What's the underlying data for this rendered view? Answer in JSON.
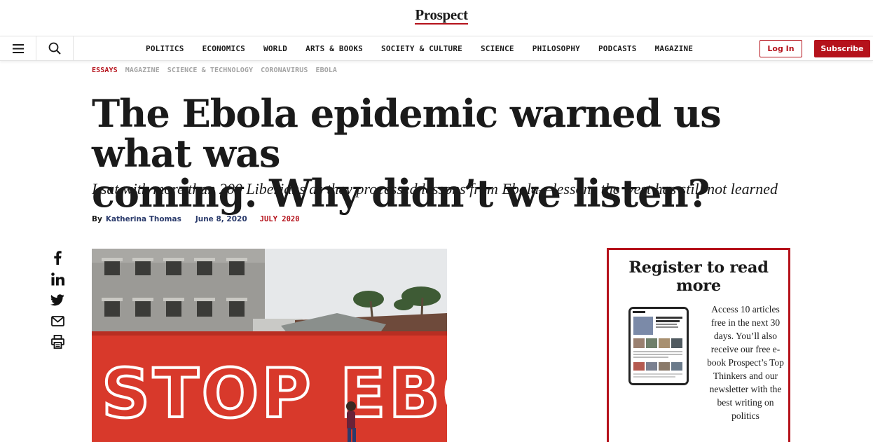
{
  "logo": {
    "text": "Prospect"
  },
  "nav": {
    "links": [
      "POLITICS",
      "ECONOMICS",
      "WORLD",
      "ARTS & BOOKS",
      "SOCIETY & CULTURE",
      "SCIENCE",
      "PHILOSOPHY",
      "PODCASTS",
      "MAGAZINE"
    ],
    "login_label": "Log In",
    "subscribe_label": "Subscribe",
    "icons": {
      "menu": "hamburger-menu-icon",
      "search": "search-icon"
    }
  },
  "article": {
    "tags": [
      "ESSAYS",
      "MAGAZINE",
      "SCIENCE & TECHNOLOGY",
      "CORONAVIRUS",
      "EBOLA"
    ],
    "headline_line1": "The Ebola epidemic warned us what was",
    "headline_line2": "coming. Why didn’t we listen?",
    "standfirst": "I sat with more than 200 Liberians as they processed lessons from Ebola—lessons the west has still not learned",
    "byline": {
      "by": "By",
      "author": "Katherina Thomas",
      "date": "June 8, 2020",
      "issue": "JULY 2020"
    },
    "hero_image": {
      "painted_text": "STOP EBOLA"
    }
  },
  "share": [
    "facebook-icon",
    "linkedin-icon",
    "twitter-icon",
    "email-icon",
    "print-icon"
  ],
  "register": {
    "title": "Register to read more",
    "copy": "Access 10 articles free in the next 30 days. You’ll also receive our free e-book Prospect’s Top Thinkers and our newsletter with the best writing on politics"
  },
  "colors": {
    "brand_red": "#b5121b",
    "author_blue": "#2a3a6b",
    "tag_grey": "#a3a3a3",
    "wall_red": "#d8392b"
  }
}
